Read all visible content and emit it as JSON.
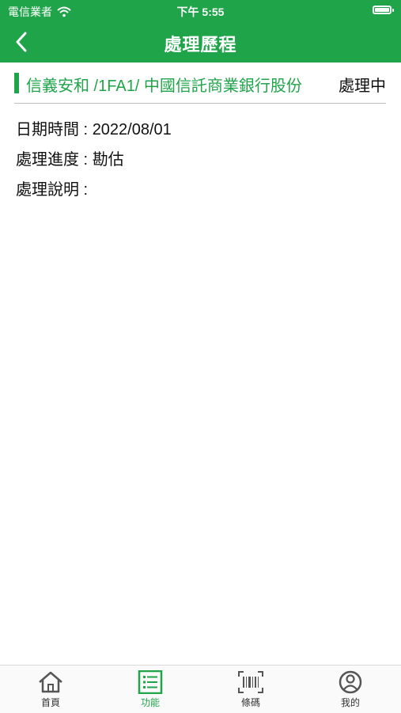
{
  "status_bar": {
    "carrier": "電信業者",
    "time": "下午 5:55"
  },
  "nav": {
    "title": "處理歷程"
  },
  "record": {
    "case_title": "信義安和 /1FA1/ 中國信託商業銀行股份",
    "status": "處理中",
    "date_label": "日期時間 :",
    "date_value": "2022/08/01",
    "progress_label": "處理進度 :",
    "progress_value": "勘估",
    "note_label": "處理說明 :",
    "note_value": ""
  },
  "tabbar": {
    "items": [
      {
        "label": "首頁",
        "icon": "home-icon"
      },
      {
        "label": "功能",
        "icon": "list-icon",
        "active": true
      },
      {
        "label": "條碼",
        "icon": "barcode-icon"
      },
      {
        "label": "我的",
        "icon": "user-icon"
      }
    ]
  },
  "colors": {
    "brand": "#20a44a"
  }
}
